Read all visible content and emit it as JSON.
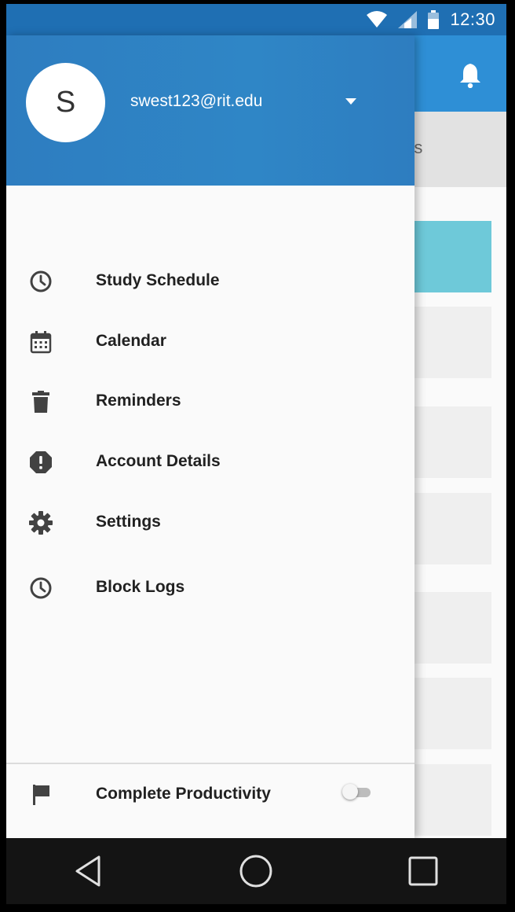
{
  "status_bar": {
    "time": "12:30",
    "icons": [
      "wifi-icon",
      "signal-icon",
      "battery-icon"
    ]
  },
  "background_app": {
    "tab_text_fragment": "rs",
    "icons": [
      "bell-icon"
    ],
    "colors": {
      "toolbar": "#2e8fd6",
      "highlight_card": "#6ec9d9"
    }
  },
  "drawer": {
    "avatar_letter": "S",
    "email": "swest123@rit.edu",
    "dropdown_icon": "arrow-drop-down-icon",
    "items": [
      {
        "label": "Study Schedule",
        "icon": "clock-icon"
      },
      {
        "label": "Calendar",
        "icon": "calendar-icon"
      },
      {
        "label": "Reminders",
        "icon": "trash-icon"
      },
      {
        "label": "Account Details",
        "icon": "alert-octagon-icon"
      },
      {
        "label": "Settings",
        "icon": "gear-icon"
      },
      {
        "label": "Block Logs",
        "icon": "clock-icon"
      }
    ],
    "footer": {
      "label": "Complete Productivity",
      "icon": "flag-icon",
      "toggle_on": false
    },
    "colors": {
      "header": "#2f86c6",
      "text": "#212121"
    }
  },
  "navigation_bar": {
    "buttons": [
      "back-icon",
      "home-icon",
      "recents-icon"
    ]
  }
}
